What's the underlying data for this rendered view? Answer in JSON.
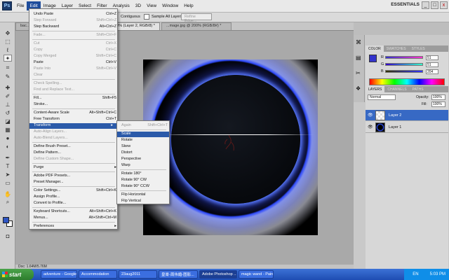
{
  "app": {
    "logo": "Ps",
    "menu": [
      "File",
      "Edit",
      "Image",
      "Layer",
      "Select",
      "Filter",
      "Analysis",
      "3D",
      "View",
      "Window",
      "Help"
    ],
    "workspace": "ESSENTIALS",
    "window_controls": [
      "_",
      "□",
      "x"
    ]
  },
  "options_bar": {
    "contiguous": "Contiguous",
    "sample_all": "Sample All Layers",
    "refine": "Refine Edge..."
  },
  "doc_tabs": [
    "bac...",
    "... 50% (Layer 2, RGB/8) *",
    "...mage.jpg @ 200% (RGB/8#) *"
  ],
  "status": {
    "text": "Doc: 1.64M/5.76M"
  },
  "edit_menu": {
    "items": [
      {
        "label": "Undo Paste",
        "shortcut": "Ctrl+Z",
        "disabled": false
      },
      {
        "label": "Step Forward",
        "shortcut": "Shift+Ctrl+Z",
        "disabled": true
      },
      {
        "label": "Step Backward",
        "shortcut": "Alt+Ctrl+Z",
        "disabled": false
      },
      {
        "label": "Fade...",
        "shortcut": "Shift+Ctrl+F",
        "disabled": true
      },
      {
        "label": "Cut",
        "shortcut": "Ctrl+X",
        "disabled": true
      },
      {
        "label": "Copy",
        "shortcut": "Ctrl+C",
        "disabled": true
      },
      {
        "label": "Copy Merged",
        "shortcut": "Shift+Ctrl+C",
        "disabled": true
      },
      {
        "label": "Paste",
        "shortcut": "Ctrl+V",
        "disabled": false
      },
      {
        "label": "Paste Into",
        "shortcut": "Shift+Ctrl+V",
        "disabled": true
      },
      {
        "label": "Clear",
        "shortcut": "",
        "disabled": true
      },
      {
        "label": "Check Spelling...",
        "shortcut": "",
        "disabled": true
      },
      {
        "label": "Find and Replace Text...",
        "shortcut": "",
        "disabled": true
      },
      {
        "label": "Fill...",
        "shortcut": "Shift+F5",
        "disabled": false
      },
      {
        "label": "Stroke...",
        "shortcut": "",
        "disabled": false
      },
      {
        "label": "Content-Aware Scale",
        "shortcut": "Alt+Shift+Ctrl+C",
        "disabled": false
      },
      {
        "label": "Free Transform",
        "shortcut": "Ctrl+T",
        "disabled": false
      },
      {
        "label": "Transform",
        "shortcut": "▸",
        "disabled": false
      },
      {
        "label": "Auto-Align Layers...",
        "shortcut": "",
        "disabled": true
      },
      {
        "label": "Auto-Blend Layers...",
        "shortcut": "",
        "disabled": true
      },
      {
        "label": "Define Brush Preset...",
        "shortcut": "",
        "disabled": false
      },
      {
        "label": "Define Pattern...",
        "shortcut": "",
        "disabled": false
      },
      {
        "label": "Define Custom Shape...",
        "shortcut": "",
        "disabled": true
      },
      {
        "label": "Purge",
        "shortcut": "▸",
        "disabled": false
      },
      {
        "label": "Adobe PDF Presets...",
        "shortcut": "",
        "disabled": false
      },
      {
        "label": "Preset Manager...",
        "shortcut": "",
        "disabled": false
      },
      {
        "label": "Color Settings...",
        "shortcut": "Shift+Ctrl+K",
        "disabled": false
      },
      {
        "label": "Assign Profile...",
        "shortcut": "",
        "disabled": false
      },
      {
        "label": "Convert to Profile...",
        "shortcut": "",
        "disabled": false
      },
      {
        "label": "Keyboard Shortcuts...",
        "shortcut": "Alt+Shift+Ctrl+K",
        "disabled": false
      },
      {
        "label": "Menus...",
        "shortcut": "Alt+Shift+Ctrl+M",
        "disabled": false
      },
      {
        "label": "Preferences",
        "shortcut": "▸",
        "disabled": false
      }
    ]
  },
  "transform_menu": {
    "items": [
      {
        "label": "Again",
        "shortcut": "Shift+Ctrl+T",
        "disabled": true
      },
      {
        "label": "Scale",
        "shortcut": "",
        "disabled": false
      },
      {
        "label": "Rotate",
        "shortcut": "",
        "disabled": false
      },
      {
        "label": "Skew",
        "shortcut": "",
        "disabled": false
      },
      {
        "label": "Distort",
        "shortcut": "",
        "disabled": false
      },
      {
        "label": "Perspective",
        "shortcut": "",
        "disabled": false
      },
      {
        "label": "Warp",
        "shortcut": "",
        "disabled": false
      },
      {
        "label": "Rotate 180°",
        "shortcut": "",
        "disabled": false
      },
      {
        "label": "Rotate 90° CW",
        "shortcut": "",
        "disabled": false
      },
      {
        "label": "Rotate 90° CCW",
        "shortcut": "",
        "disabled": false
      },
      {
        "label": "Flip Horizontal",
        "shortcut": "",
        "disabled": false
      },
      {
        "label": "Flip Vertical",
        "shortcut": "",
        "disabled": false
      }
    ]
  },
  "color_panel": {
    "tabs": [
      "COLOR",
      "SWATCHES",
      "STYLES"
    ],
    "channels": [
      {
        "label": "R",
        "value": "51"
      },
      {
        "label": "G",
        "value": "51"
      },
      {
        "label": "B",
        "value": "204"
      }
    ],
    "colors": {
      "foreground": "#3333cc",
      "background": "#ffffff"
    }
  },
  "layers_panel": {
    "tabs": [
      "LAYERS",
      "CHANNELS",
      "PATHS"
    ],
    "blend_mode": "Normal",
    "opacity_label": "Opacity:",
    "opacity_value": "100%",
    "fill_label": "Fill:",
    "fill_value": "100%",
    "layers": [
      {
        "name": "Layer 2",
        "selected": true
      },
      {
        "name": "Layer 1",
        "selected": false
      }
    ]
  },
  "taskbar": {
    "start": "start",
    "buttons": [
      {
        "label": "adventure - Google...",
        "active": false
      },
      {
        "label": "Accommodation",
        "active": false
      },
      {
        "label": "23aug2011",
        "active": false
      },
      {
        "label": "皇膏-周伟婚-图影...",
        "active": false
      },
      {
        "label": "Adobe Photoshop ...",
        "active": true
      },
      {
        "label": "magic wand - Paint",
        "active": false
      }
    ],
    "tray": {
      "lang": "EN",
      "time": "5:03 PM"
    }
  }
}
